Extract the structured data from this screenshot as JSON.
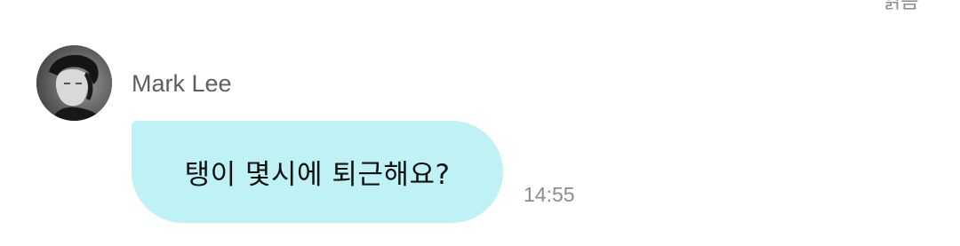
{
  "header": {
    "read_label": "읽음"
  },
  "message": {
    "sender": "Mark Lee",
    "avatar_icon": "profile-photo",
    "text": "탱이 몇시에 퇴근해요?",
    "time": "14:55",
    "bubble_color": "#bff2f4"
  }
}
